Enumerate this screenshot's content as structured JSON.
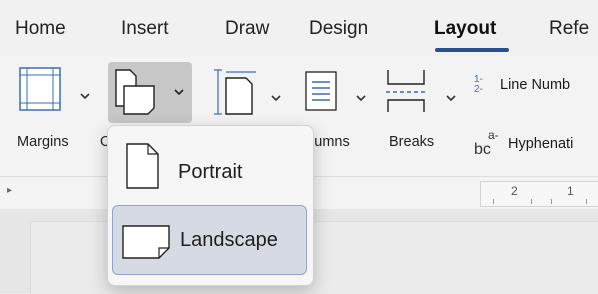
{
  "tabs": [
    {
      "label": "Home"
    },
    {
      "label": "Insert"
    },
    {
      "label": "Draw"
    },
    {
      "label": "Design"
    },
    {
      "label": "Layout",
      "active": true
    },
    {
      "label": "Refe"
    }
  ],
  "ribbon": {
    "margins_label": "Margins",
    "orientation_label": "O",
    "columns_label": "olumns",
    "breaks_label": "Breaks",
    "line_numbers_label": "Line Numb",
    "line_numbers_icon_text": "1- 2-",
    "hyphenation_label": "Hyphenati",
    "hyphenation_icon_text_top": "a-",
    "hyphenation_icon_text_bottom": "bc"
  },
  "ruler": {
    "numbers": [
      "2",
      "1"
    ]
  },
  "orientation_menu": {
    "items": [
      {
        "label": "Portrait",
        "icon": "portrait-page-icon",
        "selected": false
      },
      {
        "label": "Landscape",
        "icon": "landscape-page-icon",
        "selected": true
      }
    ]
  },
  "colors": {
    "accent": "#2b4f8a",
    "selection_bg": "#d6dbe3",
    "selection_border": "#8fa6c8"
  }
}
